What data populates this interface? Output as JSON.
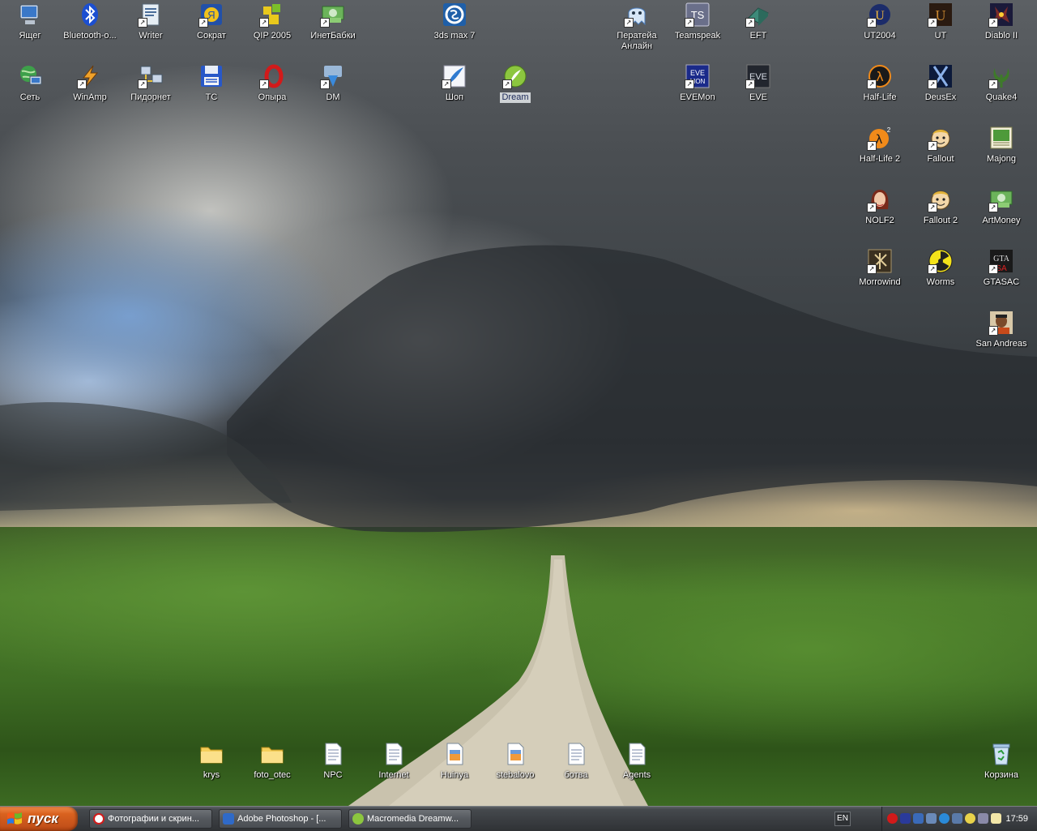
{
  "desktop": {
    "icons_top": [
      {
        "label": "Ящег",
        "icon": "my-computer-icon"
      },
      {
        "label": "Bluetooth-о...",
        "icon": "bluetooth-icon"
      },
      {
        "label": "Writer",
        "icon": "writer-icon"
      },
      {
        "label": "Сократ",
        "icon": "sokrat-icon"
      },
      {
        "label": "QIP 2005",
        "icon": "qip-icon"
      },
      {
        "label": "ИнетБабки",
        "icon": "money-icon"
      },
      {
        "label": "3ds max 7",
        "icon": "3ds-max-icon"
      },
      {
        "label": "Ператейа Анлайн",
        "icon": "ghost-icon"
      },
      {
        "label": "Teamspeak",
        "icon": "teamspeak-icon"
      },
      {
        "label": "EFT",
        "icon": "eft-icon"
      },
      {
        "label": "UT2004",
        "icon": "ut2004-icon"
      },
      {
        "label": "UT",
        "icon": "ut-icon"
      },
      {
        "label": "Diablo II",
        "icon": "diablo-icon"
      }
    ],
    "icons_row2": [
      {
        "label": "Сеть",
        "icon": "network-icon"
      },
      {
        "label": "WinAmp",
        "icon": "winamp-icon"
      },
      {
        "label": "Пидорнет",
        "icon": "network-setup-icon"
      },
      {
        "label": "TC",
        "icon": "floppy-icon"
      },
      {
        "label": "Опыра",
        "icon": "opera-icon"
      },
      {
        "label": "DM",
        "icon": "download-master-icon"
      },
      {
        "label": "Шоп",
        "icon": "photoshop-feather-icon"
      },
      {
        "label": "Dream",
        "icon": "dreamweaver-icon"
      },
      {
        "label": "EVEMon",
        "icon": "evemon-icon"
      },
      {
        "label": "EVE",
        "icon": "eve-icon"
      },
      {
        "label": "Half-Life",
        "icon": "half-life-icon"
      },
      {
        "label": "DeusEx",
        "icon": "deusex-icon"
      },
      {
        "label": "Quake4",
        "icon": "quake-icon"
      }
    ],
    "icons_right": [
      {
        "label": "Half-Life 2",
        "icon": "half-life-2-icon"
      },
      {
        "label": "Fallout",
        "icon": "fallout-icon"
      },
      {
        "label": "Majong",
        "icon": "majong-icon"
      },
      {
        "label": "NOLF2",
        "icon": "nolf2-icon"
      },
      {
        "label": "Fallout 2",
        "icon": "fallout-2-icon"
      },
      {
        "label": "ArtMoney",
        "icon": "artmoney-icon"
      },
      {
        "label": "Morrowind",
        "icon": "morrowind-icon"
      },
      {
        "label": "Worms",
        "icon": "radiation-icon"
      },
      {
        "label": "GTASAC",
        "icon": "gtasac-icon"
      },
      {
        "label": "San Andreas",
        "icon": "san-andreas-icon"
      }
    ],
    "icons_bottom": [
      {
        "label": "krys",
        "icon": "folder-icon"
      },
      {
        "label": "foto_otec",
        "icon": "folder-icon"
      },
      {
        "label": "NPC",
        "icon": "text-file-icon"
      },
      {
        "label": "Internet",
        "icon": "text-file-icon"
      },
      {
        "label": "Huinya",
        "icon": "image-file-icon"
      },
      {
        "label": "stebalovo",
        "icon": "image-file-icon"
      },
      {
        "label": "ботва",
        "icon": "text-file-icon"
      },
      {
        "label": "Agents",
        "icon": "text-file-icon"
      }
    ],
    "recycle_bin": {
      "label": "Корзина",
      "icon": "recycle-bin-icon"
    }
  },
  "taskbar": {
    "start_label": "пуск",
    "tasks": [
      {
        "label": "Фотографии и скрин...",
        "icon": "opera-icon"
      },
      {
        "label": "Adobe Photoshop - [...",
        "icon": "photoshop-icon"
      },
      {
        "label": "Macromedia Dreamw...",
        "icon": "dreamweaver-icon"
      }
    ],
    "language": "EN",
    "clock": "17:59"
  },
  "colors": {
    "start_button": "#d9621f",
    "taskbar": "#393c40",
    "selected_label_bg": "#cfd3d6"
  }
}
